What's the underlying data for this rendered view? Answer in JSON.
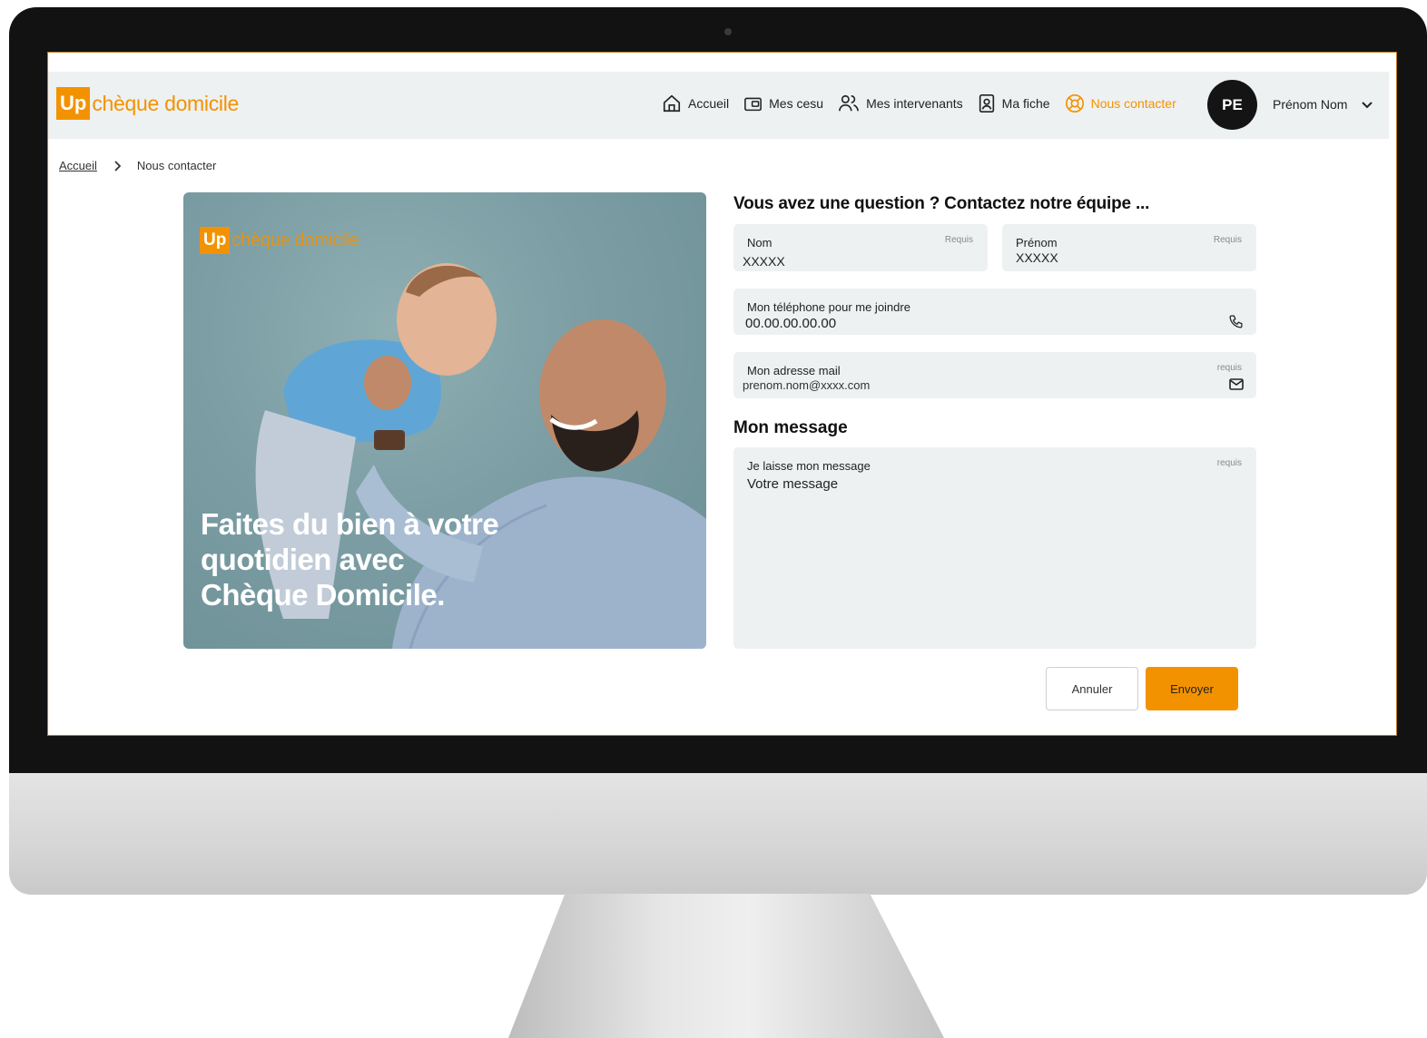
{
  "brand": {
    "badge": "Up",
    "name": "chèque domicile",
    "color": "#f39200"
  },
  "nav": {
    "items": [
      {
        "label": "Accueil",
        "icon": "home-icon"
      },
      {
        "label": "Mes cesu",
        "icon": "wallet-icon"
      },
      {
        "label": "Mes intervenants",
        "icon": "users-icon"
      },
      {
        "label": "Ma fiche",
        "icon": "contact-card-icon"
      },
      {
        "label": "Nous contacter",
        "icon": "lifebuoy-icon",
        "active": true
      }
    ]
  },
  "user": {
    "initials": "PE",
    "name": "Prénom Nom",
    "menu_icon": "chevron-down-icon"
  },
  "breadcrumb": {
    "home": "Accueil",
    "current": "Nous contacter"
  },
  "hero": {
    "logo_badge": "Up",
    "logo_name": "chèque domicile",
    "tagline_lines": [
      "Faites du bien à votre",
      "quotidien avec",
      "Chèque Domicile."
    ]
  },
  "form": {
    "title": "Vous avez une question ? Contactez notre équipe ...",
    "nom": {
      "label": "Nom",
      "required": "Requis",
      "value": "XXXXX"
    },
    "prenom": {
      "label": "Prénom",
      "required": "Requis",
      "value": "XXXXX"
    },
    "phone": {
      "label": "Mon téléphone pour me joindre",
      "value": "00.00.00.00.00",
      "icon": "phone-icon"
    },
    "email": {
      "label": "Mon adresse mail",
      "required": "requis",
      "value": "prenom.nom@xxxx.com",
      "icon": "mail-icon"
    },
    "message_title": "Mon message",
    "message": {
      "label": "Je laisse mon message",
      "required": "requis",
      "placeholder": "Votre message"
    },
    "cancel": "Annuler",
    "send": "Envoyer"
  }
}
